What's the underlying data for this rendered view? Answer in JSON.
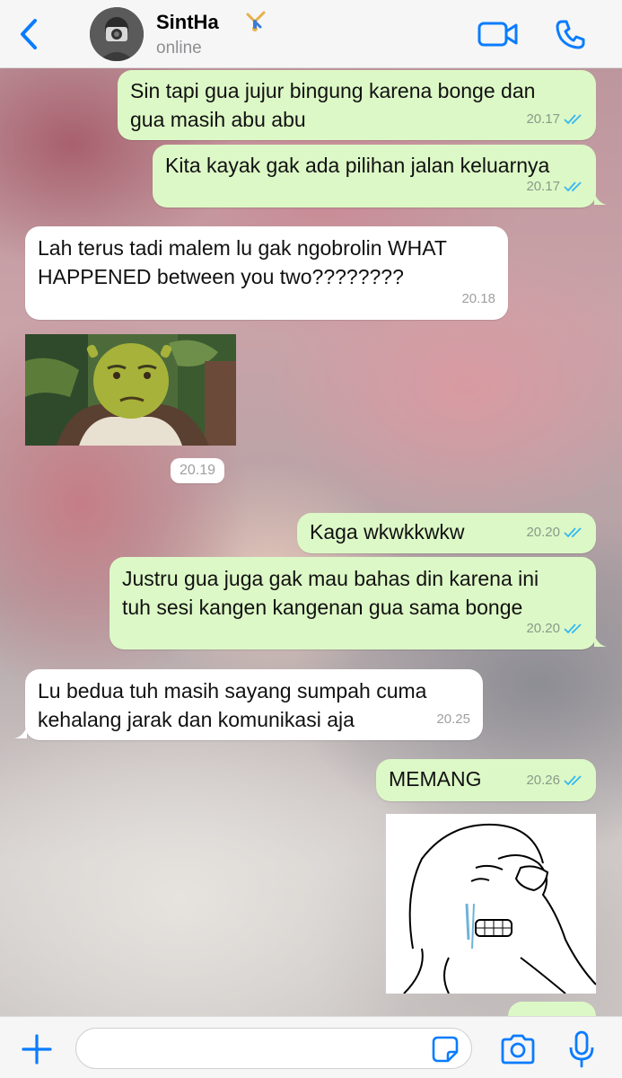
{
  "header": {
    "contact_name": "SintHa",
    "status": "online",
    "back_icon": "chevron-left-icon",
    "video_icon": "video-camera-icon",
    "call_icon": "phone-icon"
  },
  "colors": {
    "accent": "#0a7cff",
    "outgoing_bubble": "#dcf8c6",
    "incoming_bubble": "#ffffff",
    "read_tick": "#34b7f1"
  },
  "messages": [
    {
      "dir": "out",
      "text_lines": [
        "Sin tapi gua jujur bingung karena bonge dan",
        "gua masih abu abu"
      ],
      "time": "20.17"
    },
    {
      "dir": "out",
      "text_lines": [
        "Kita kayak gak ada pilihan jalan keluarnya"
      ],
      "time": "20.17"
    },
    {
      "dir": "in",
      "text_lines": [
        "Lah terus tadi malem lu gak ngobrolin WHAT",
        "HAPPENED between you two????????"
      ],
      "time": "20.18"
    },
    {
      "dir": "in",
      "type": "image",
      "image_desc": "shrek-meme-image",
      "time": "20.19"
    },
    {
      "dir": "out",
      "text_lines": [
        "Kaga wkwkkwkw"
      ],
      "time": "20.20"
    },
    {
      "dir": "out",
      "text_lines": [
        "Justru gua juga gak mau bahas din karena ini",
        "tuh sesi kangen kangenan gua sama bonge"
      ],
      "time": "20.20"
    },
    {
      "dir": "in",
      "text_lines": [
        "Lu bedua tuh masih sayang sumpah cuma",
        "kehalang jarak dan komunikasi aja"
      ],
      "time": "20.25"
    },
    {
      "dir": "out",
      "text_lines": [
        "MEMANG"
      ],
      "time": "20.26"
    },
    {
      "dir": "out",
      "type": "image",
      "image_desc": "crying-wojak-image"
    }
  ],
  "composer": {
    "placeholder": "",
    "plus_icon": "plus-icon",
    "sticker_icon": "sticker-icon",
    "camera_icon": "camera-icon",
    "mic_icon": "microphone-icon"
  }
}
